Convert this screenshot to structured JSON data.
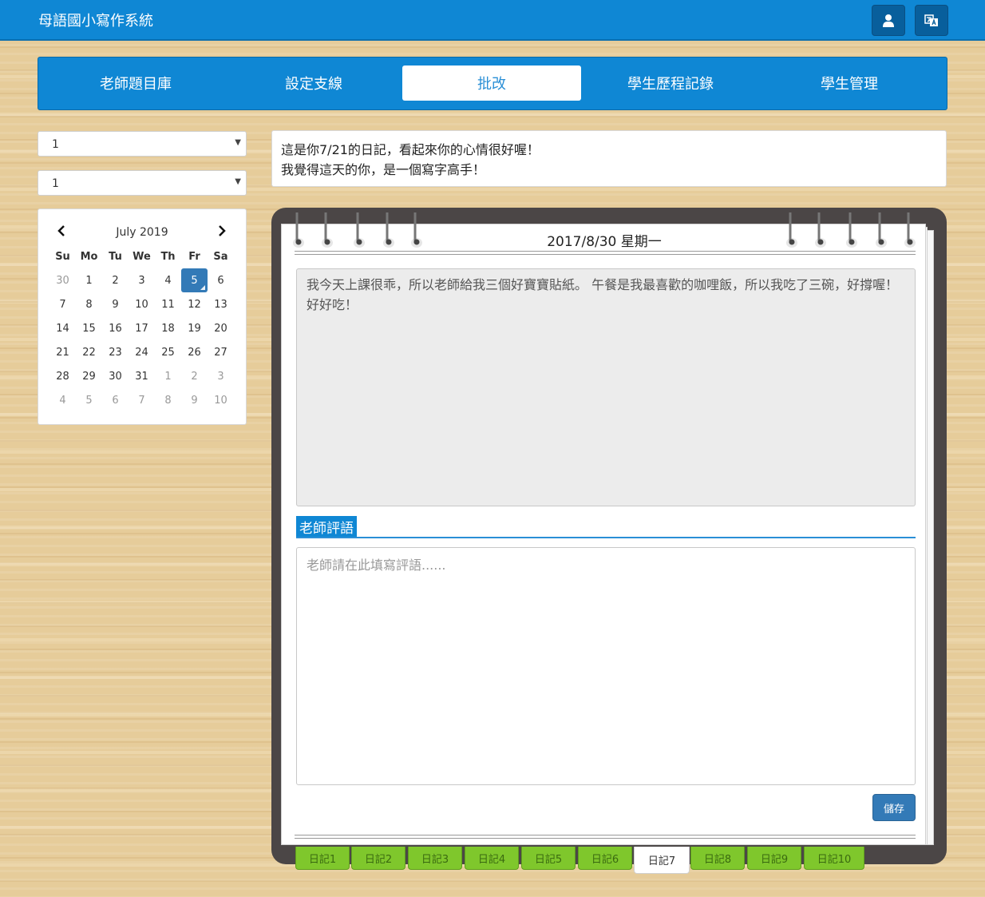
{
  "header": {
    "app_title": "母語國小寫作系統",
    "icons": [
      "user-icon",
      "translate-icon"
    ]
  },
  "nav": {
    "tabs": [
      {
        "label": "老師題目庫"
      },
      {
        "label": "設定支線"
      },
      {
        "label": "批改",
        "active": true
      },
      {
        "label": "學生歷程記錄"
      },
      {
        "label": "學生管理"
      }
    ]
  },
  "filters": {
    "select1": "1",
    "select2": "1"
  },
  "calendar": {
    "month_label": "July 2019",
    "weekdays": [
      "Su",
      "Mo",
      "Tu",
      "We",
      "Th",
      "Fr",
      "Sa"
    ],
    "weeks": [
      [
        "30",
        "1",
        "2",
        "3",
        "4",
        "5",
        "6"
      ],
      [
        "7",
        "8",
        "9",
        "10",
        "11",
        "12",
        "13"
      ],
      [
        "14",
        "15",
        "16",
        "17",
        "18",
        "19",
        "20"
      ],
      [
        "21",
        "22",
        "23",
        "24",
        "25",
        "26",
        "27"
      ],
      [
        "28",
        "29",
        "30",
        "31",
        "1",
        "2",
        "3"
      ],
      [
        "4",
        "5",
        "6",
        "7",
        "8",
        "9",
        "10"
      ]
    ],
    "selected_day": "5"
  },
  "message": {
    "line1": "這是你7/21的日記，看起來你的心情很好喔！",
    "line2": "我覺得這天的你，是一個寫字高手！"
  },
  "notebook": {
    "date": "2017/8/30 星期一",
    "diary_text": "我今天上課很乖，所以老師給我三個好寶寶貼紙。 午餐是我最喜歡的咖哩飯，所以我吃了三碗，好撐喔！ 好好吃！",
    "comment_label": "老師評語",
    "comment_placeholder": "老師請在此填寫評語......",
    "save_label": "儲存"
  },
  "diary_tabs": [
    {
      "label": "日記1"
    },
    {
      "label": "日記2"
    },
    {
      "label": "日記3"
    },
    {
      "label": "日記4"
    },
    {
      "label": "日記5"
    },
    {
      "label": "日記6"
    },
    {
      "label": "日記7",
      "active": true
    },
    {
      "label": "日記8"
    },
    {
      "label": "日記9"
    },
    {
      "label": "日記10"
    }
  ],
  "colors": {
    "primary": "#0f87d4",
    "button": "#337ab7",
    "tab_green": "#7fc72c",
    "wood": "#e6cc9a",
    "notebook_frame": "#4b4646"
  }
}
